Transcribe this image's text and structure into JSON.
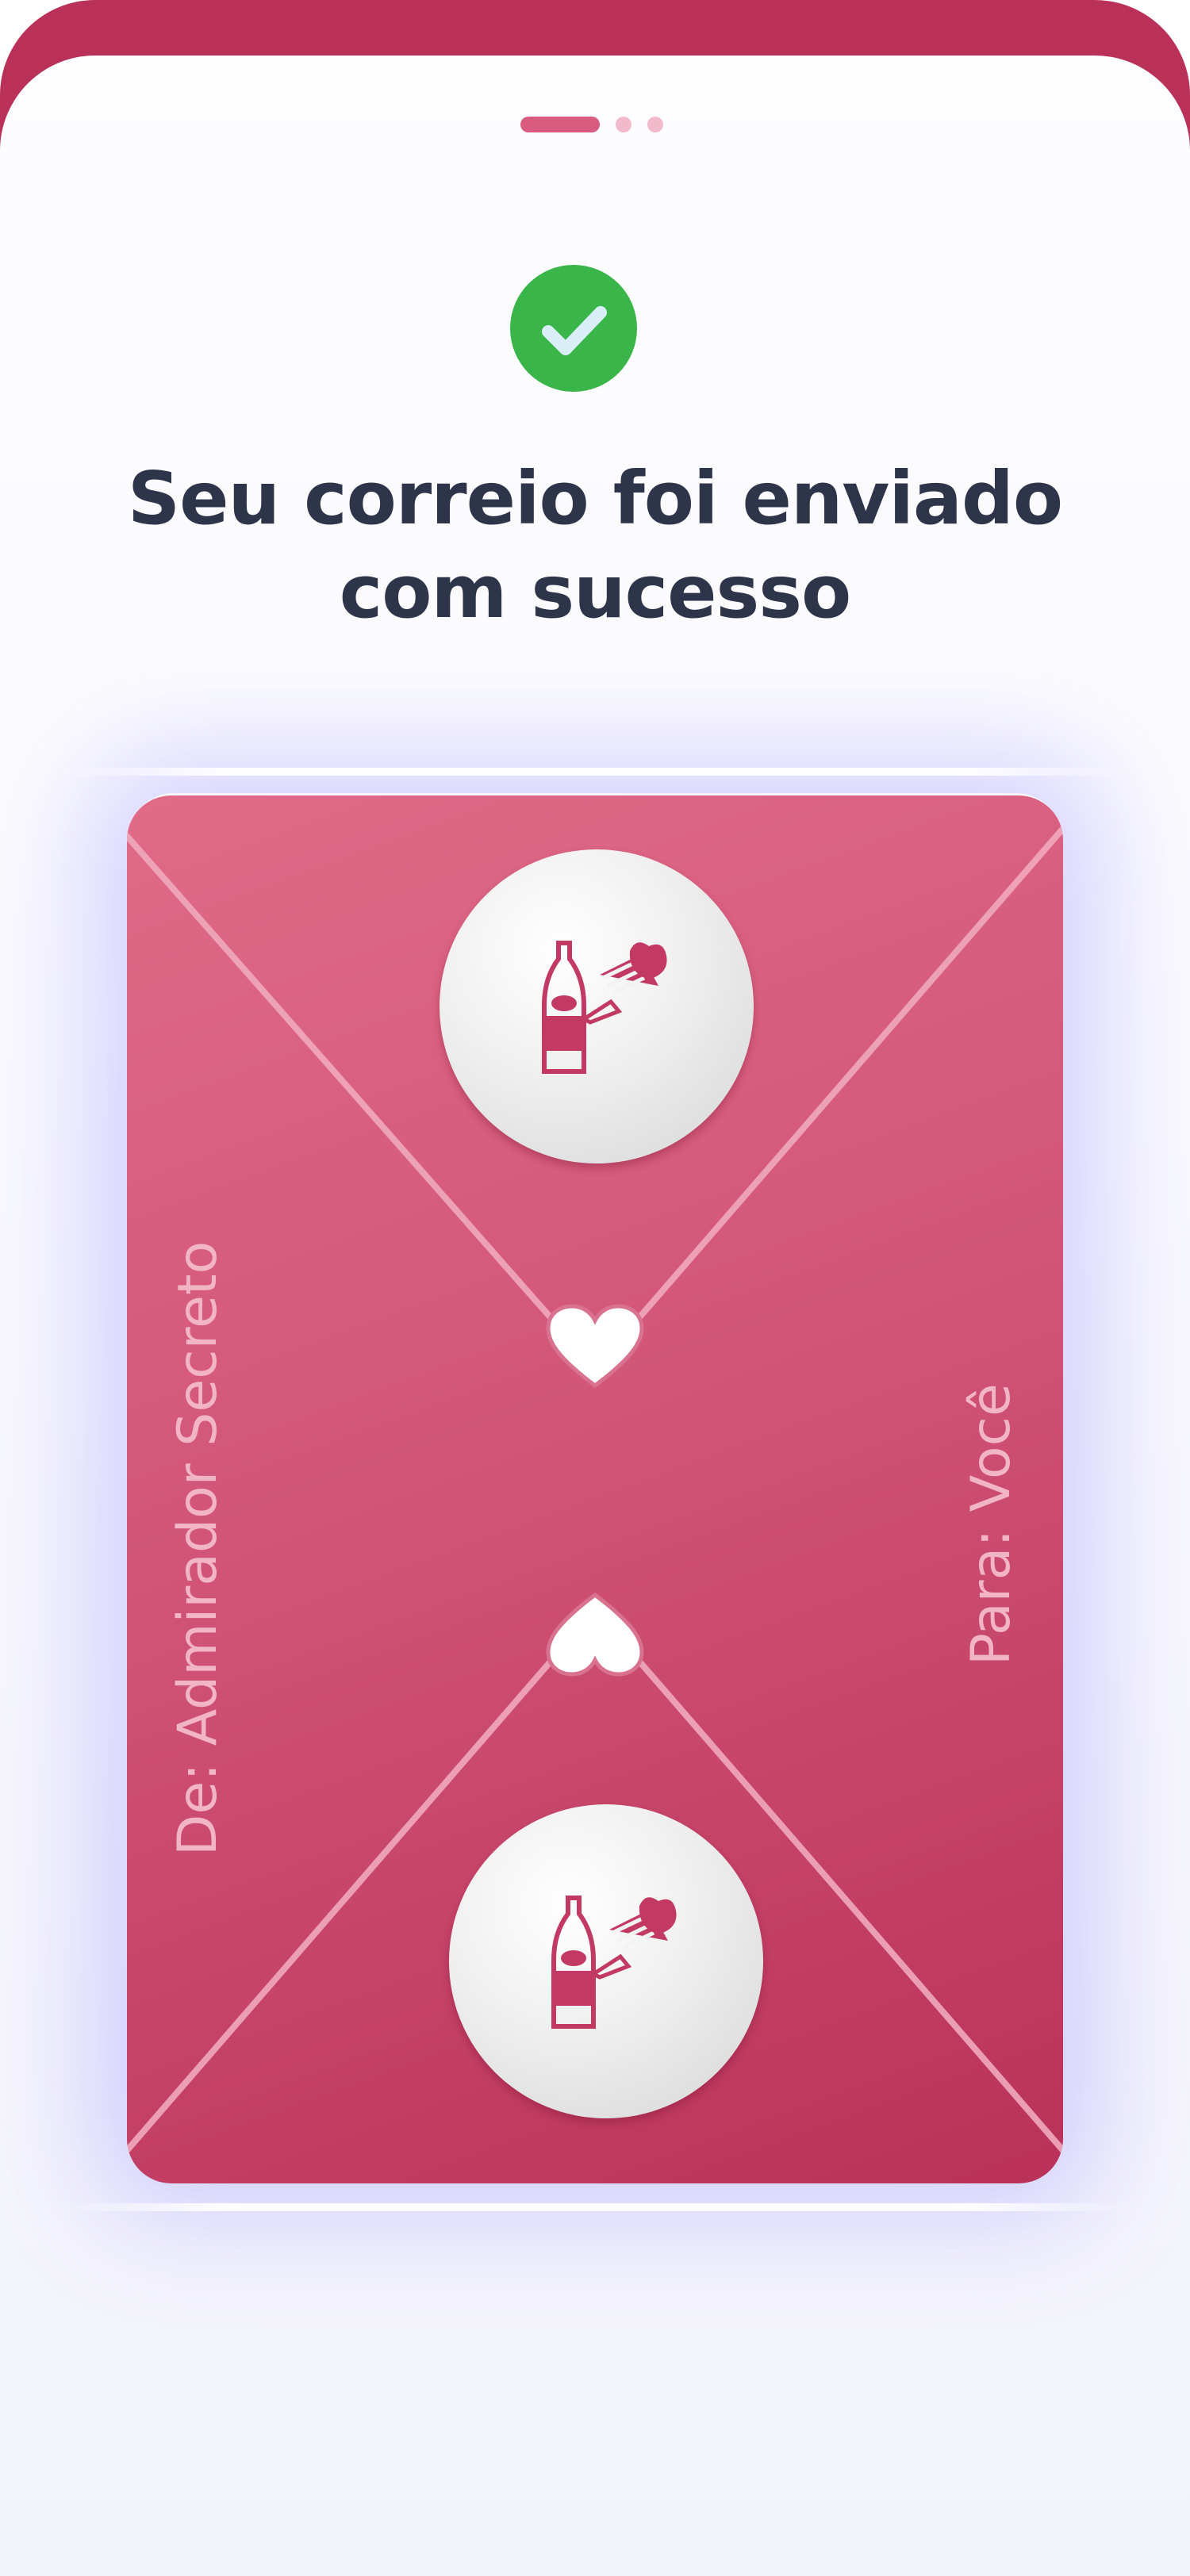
{
  "header": {
    "pager": {
      "active_index": 0,
      "count": 3
    }
  },
  "success": {
    "icon": "check-circle-icon",
    "icon_color": "#3ab54a",
    "title_line1": "Seu correio foi enviado",
    "title_line2": "com sucesso"
  },
  "envelope": {
    "color_light": "#e06a88",
    "color_dark": "#b93159",
    "from_label": "De: Admirador Secreto",
    "to_label": "Para: Você",
    "stamp_icon": "champagne-celebration-icon",
    "seal_icon": "heart-icon"
  },
  "colors": {
    "brand": "#b93159",
    "title_text": "#2e3449"
  }
}
